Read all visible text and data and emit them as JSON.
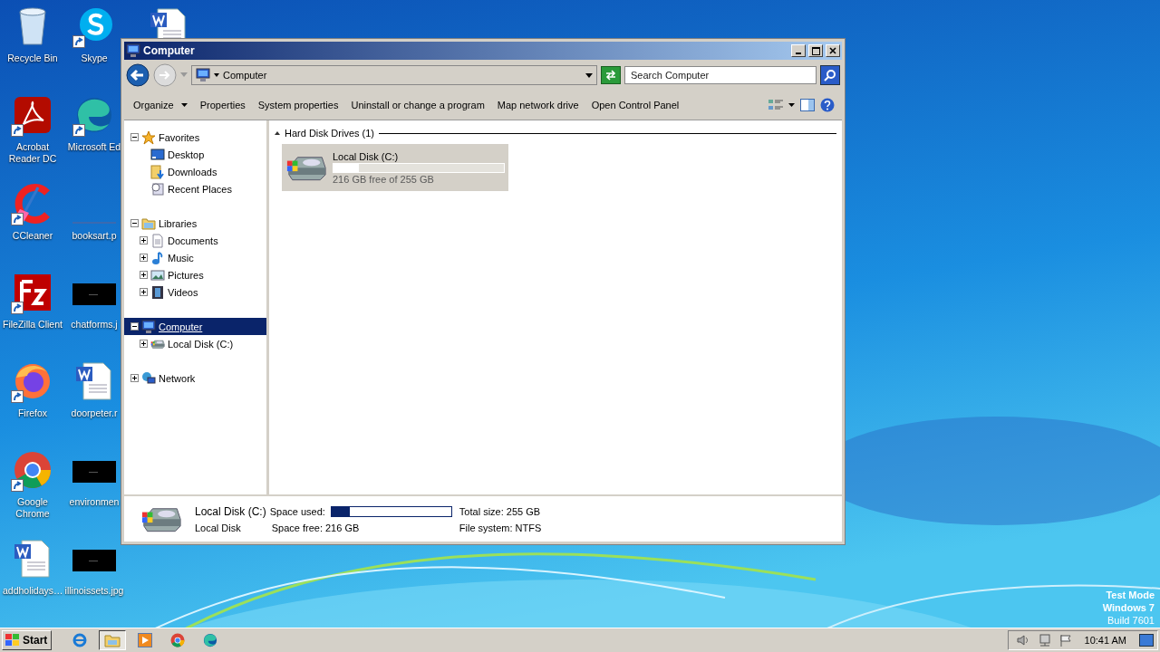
{
  "desktop_icons": [
    {
      "label": "Recycle Bin",
      "shortcut": false
    },
    {
      "label": "Acrobat Reader DC",
      "shortcut": true
    },
    {
      "label": "CCleaner",
      "shortcut": true
    },
    {
      "label": "FileZilla Client",
      "shortcut": true
    },
    {
      "label": "Firefox",
      "shortcut": true
    },
    {
      "label": "Google Chrome",
      "shortcut": true
    },
    {
      "label": "addholidays…",
      "shortcut": false
    },
    {
      "label": "Skype",
      "shortcut": true
    },
    {
      "label": "Microsoft Ed",
      "shortcut": true
    },
    {
      "label": "booksart.p",
      "shortcut": false
    },
    {
      "label": "chatforms.j",
      "shortcut": false
    },
    {
      "label": "doorpeter.r",
      "shortcut": false
    },
    {
      "label": "environmen",
      "shortcut": false
    },
    {
      "label": "illinoissets.jpg",
      "shortcut": false
    }
  ],
  "window": {
    "title": "Computer",
    "address": "Computer",
    "search": {
      "placeholder": "Search Computer"
    },
    "toolbar": [
      {
        "label": "Organize",
        "kind": "menu"
      },
      {
        "label": "Properties",
        "kind": "plain"
      },
      {
        "label": "System properties",
        "kind": "plain"
      },
      {
        "label": "Uninstall or change a program",
        "kind": "plain"
      },
      {
        "label": "Map network drive",
        "kind": "plain"
      },
      {
        "label": "Open Control Panel",
        "kind": "plain"
      }
    ],
    "nav": [
      {
        "label": "Favorites",
        "expanded": true,
        "selected": false,
        "children": [
          {
            "label": "Desktop",
            "selected": false
          },
          {
            "label": "Downloads",
            "selected": false
          },
          {
            "label": "Recent Places",
            "selected": false
          }
        ]
      },
      {
        "label": "Libraries",
        "expanded": true,
        "selected": false,
        "children": [
          {
            "label": "Documents",
            "expanded": false,
            "selected": false
          },
          {
            "label": "Music",
            "expanded": false,
            "selected": false
          },
          {
            "label": "Pictures",
            "expanded": false,
            "selected": false
          },
          {
            "label": "Videos",
            "expanded": false,
            "selected": false
          }
        ]
      },
      {
        "label": "Computer",
        "expanded": true,
        "selected": true,
        "children": [
          {
            "label": "Local Disk (C:)",
            "expanded": false,
            "selected": false
          }
        ]
      },
      {
        "label": "Network",
        "expanded": false,
        "selected": false
      }
    ],
    "group": {
      "title": "Hard Disk Drives (1)",
      "expanded": true,
      "drives": [
        {
          "name": "Local Disk (C:)",
          "level": 0.15,
          "free_text": "216 GB free of 255 GB",
          "selected": true
        }
      ]
    },
    "details": {
      "name": "Local Disk (C:)",
      "type": "Local Disk",
      "used_label": "Space used:",
      "level": 0.15,
      "free": "Space free: 216 GB",
      "total": "Total size: 255 GB",
      "file_system": "File system: NTFS"
    }
  },
  "taskbar": {
    "start": "Start",
    "buttons": [
      {
        "active": false
      },
      {
        "active": true
      },
      {
        "active": false
      },
      {
        "active": false
      },
      {
        "active": false
      }
    ],
    "clock": "10:41 AM"
  },
  "watermark_lines": [
    "Test Mode",
    "Windows 7",
    "Build 7601"
  ]
}
